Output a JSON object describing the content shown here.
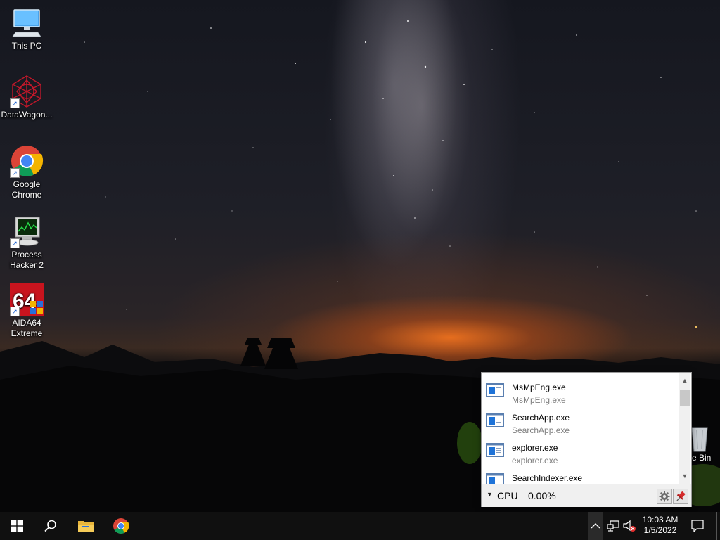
{
  "desktop": {
    "icons": [
      {
        "label": "This PC",
        "icon": "computer-icon"
      },
      {
        "label": "DataWagon...",
        "icon": "datawagon-icon"
      },
      {
        "label": "Google Chrome",
        "icon": "chrome-icon"
      },
      {
        "label": "Process Hacker 2",
        "icon": "process-hacker-icon"
      },
      {
        "label": "AIDA64 Extreme",
        "icon": "aida64-icon",
        "badge": "64"
      },
      {
        "label": "e Bin",
        "icon": "recycle-bin-icon"
      }
    ]
  },
  "popup": {
    "processes": [
      {
        "name": "MsMpEng.exe",
        "subtitle": "MsMpEng.exe"
      },
      {
        "name": "SearchApp.exe",
        "subtitle": "SearchApp.exe"
      },
      {
        "name": "explorer.exe",
        "subtitle": "explorer.exe"
      },
      {
        "name": "SearchIndexer.exe",
        "subtitle": ""
      }
    ],
    "footer": {
      "metric_label": "CPU",
      "metric_value": "0.00%"
    }
  },
  "taskbar": {
    "clock_time": "10:03 AM",
    "clock_date": "1/5/2022"
  },
  "colors": {
    "taskbar_bg": "#101010",
    "accent": "#1a73e8",
    "popup_bg": "#ffffff",
    "tray_highlight": "#2a2a2a"
  }
}
